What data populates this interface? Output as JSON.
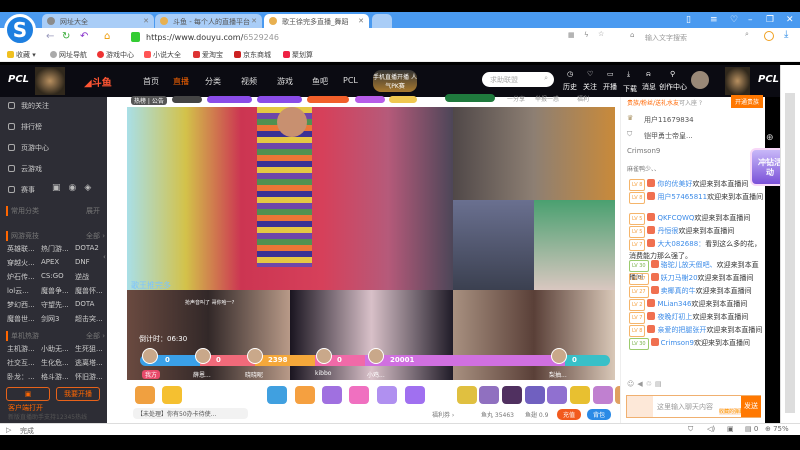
{
  "browser": {
    "tabs": [
      {
        "title": "网址大全"
      },
      {
        "title": "斗鱼 - 每个人的直播平台"
      },
      {
        "title": "歌王徐完多直播_舞蹈"
      }
    ],
    "url_host": "https://www.douyu.com/",
    "url_path": "6529246",
    "search_placeholder": "输入文字搜索",
    "bookmarks": [
      "收藏",
      "网址导航",
      "游戏中心",
      "小说大全",
      "爱淘宝",
      "京东商城",
      "聚划算"
    ],
    "status_text": "完成",
    "zoom": "75%",
    "download_count": "0"
  },
  "douyu": {
    "brand_left": "PCL",
    "brand_right": "PCL",
    "logo": "斗鱼",
    "nav": [
      "首页",
      "直播",
      "分类",
      "视频",
      "游戏",
      "鱼吧",
      "PCL"
    ],
    "promo": "手机直播开播 人气PK赛",
    "search_placeholder": "求助联盟",
    "user_menu": [
      "历史",
      "关注",
      "开播",
      "下载",
      "消息",
      "创作中心"
    ],
    "sidebar": {
      "items": [
        "我的关注",
        "排行榜",
        "页游中心",
        "云游戏",
        "赛事"
      ],
      "common_label": "常用分类",
      "common_more": "展开",
      "online": {
        "label": "网游竞技",
        "more": "全部 ›",
        "games": [
          "英雄联...",
          "热门游...",
          "DOTA2",
          "穿越火...",
          "APEX",
          "DNF",
          "炉石传...",
          "CS:GO",
          "逆战",
          "lol云...",
          "魔兽争...",
          "魔兽怀...",
          "梦幻西...",
          "守望先...",
          "DOTA",
          "魔兽世...",
          "剑网3",
          "超击突..."
        ]
      },
      "single": {
        "label": "单机热游",
        "more": "全部 ›",
        "games": [
          "主机游...",
          "小助无...",
          "生死狙...",
          "社交互...",
          "生化危...",
          "逃离塔...",
          "卧龙：...",
          "格斗游...",
          "怀旧游..."
        ]
      },
      "client_btn": "客户端打开",
      "start_btn": "我要开播",
      "footer": "新版直播助手支持12345热线"
    },
    "room": {
      "notice": "热榜 | 公告",
      "badges": [
        "",
        "",
        "",
        "",
        "",
        ""
      ],
      "right_info": [
        "一分享",
        "举报一惑",
        "福利"
      ],
      "streamer_tag": "歌王推完多",
      "pk_timer": "倒计时：06:30",
      "pk_bubble": "抢声音叫了 哥你哈一?",
      "pk_players": [
        {
          "name": "我方",
          "score": "0"
        },
        {
          "name": "薛恩...",
          "score": "0"
        },
        {
          "name": "晓晓昵",
          "score": "2398"
        },
        {
          "name": "kibbo",
          "score": "0"
        },
        {
          "name": "小鸡...",
          "score": "20001"
        },
        {
          "name": "梨抽...",
          "score": "0"
        }
      ],
      "notice_bar": "【未处理】你有50办卡待使...",
      "welfare": "福利券 ›",
      "fish_balls": "鱼丸 35463",
      "fish_fins": "鱼翅 0.9",
      "recharge": "充值",
      "backpack": "背包"
    },
    "chat": {
      "noble_text": "贵族/粉丝/送礼水友",
      "noble_suffix": "可入座 ?",
      "open_noble": "开通贵族",
      "seats": [
        "用户11679834",
        "铠甲勇士帝皇...",
        "Crimson9",
        "麻雀鸭少、、"
      ],
      "event_badge": "冲钻活动",
      "messages": [
        {
          "lv": "LV 8",
          "name": "你的优美好",
          "text": "欢迎来到本直播间"
        },
        {
          "lv": "LV 8",
          "name": "用户57465811",
          "text": "欢迎来到本直播间"
        },
        {
          "lv": "LV 5",
          "name": "QKFCQWQ",
          "text": "欢迎来到本直播间"
        },
        {
          "lv": "LV 5",
          "name": "丹恒很",
          "text": "欢迎来到本直播间"
        },
        {
          "lv": "LV 7",
          "name": "大大082688：",
          "text": "看到这么多的花，消费能力那么强了。"
        },
        {
          "lv": "LV 30",
          "name": "骆驼儿放天假吧、",
          "text": "欢迎来到本直播间"
        },
        {
          "lv": "LV 27",
          "name": "妖刀马榭20",
          "text": "欢迎来到本直播间"
        },
        {
          "lv": "LV 27",
          "name": "卖椰真的牛",
          "text": "欢迎来到本直播间"
        },
        {
          "lv": "LV 2",
          "name": "MLian346",
          "text": "欢迎来到本直播间"
        },
        {
          "lv": "LV 7",
          "name": "夜晚灯初上",
          "text": "欢迎来到本直播间"
        },
        {
          "lv": "LV 8",
          "name": "亲爱的把腿张开",
          "text": "欢迎来到本直播间"
        },
        {
          "lv": "LV 30",
          "name": "Crimson9",
          "text": "欢迎来到本直播间"
        }
      ],
      "input_placeholder": "这里输入聊天内容",
      "send": "发送",
      "emoji_hint": "收藏的弹幕"
    },
    "colors": {
      "accent": "#ff7800",
      "tabbar": "#4a9af0",
      "sidebar": "#2d2d35"
    }
  }
}
